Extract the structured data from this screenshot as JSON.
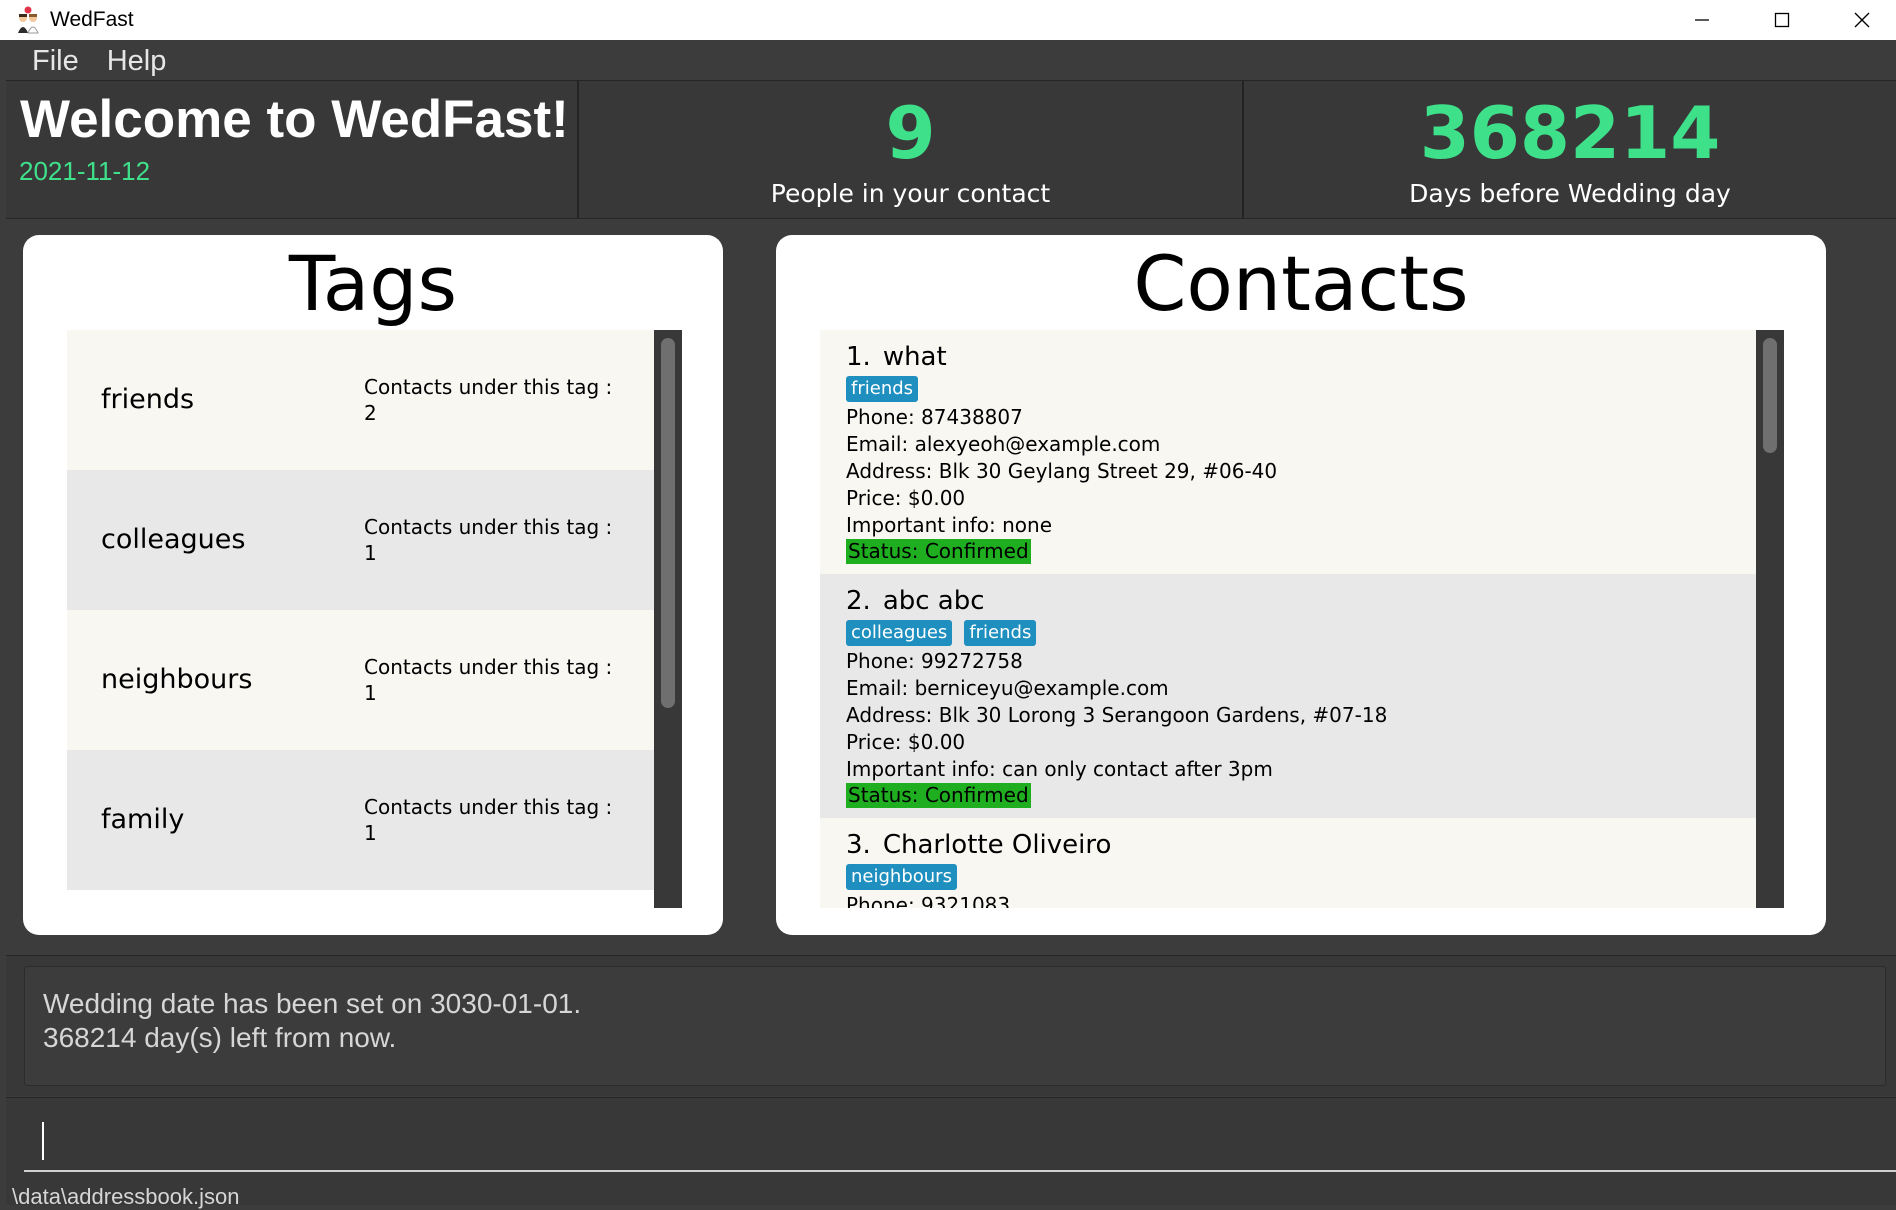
{
  "window": {
    "title": "WedFast",
    "icon": "wedding-couple-icon",
    "controls": [
      "minimize-icon",
      "maximize-icon",
      "close-icon"
    ]
  },
  "menu": {
    "file": "File",
    "help": "Help"
  },
  "header": {
    "welcome": "Welcome to WedFast!",
    "date": "2021-11-12",
    "people_count": "9",
    "people_label": "People in your contact",
    "days_count": "368214",
    "days_label": "Days before Wedding day"
  },
  "colors": {
    "accent_green": "#3fe08a",
    "tag_badge": "#1f8fbf",
    "status_confirmed": "#1fae1f"
  },
  "tags_panel": {
    "heading": "Tags",
    "count_label": "Contacts under this tag :",
    "items": [
      {
        "name": "friends",
        "count": "2"
      },
      {
        "name": "colleagues",
        "count": "1"
      },
      {
        "name": "neighbours",
        "count": "1"
      },
      {
        "name": "family",
        "count": "1"
      }
    ]
  },
  "contacts_panel": {
    "heading": "Contacts",
    "items": [
      {
        "index": "1.",
        "name": "what",
        "tags": [
          "friends"
        ],
        "phone": "Phone: 87438807",
        "email": "Email: alexyeoh@example.com",
        "address": "Address: Blk 30 Geylang Street 29, #06-40",
        "price": "Price: $0.00",
        "info": "Important info: none",
        "status": "Status: Confirmed"
      },
      {
        "index": "2.",
        "name": "abc abc",
        "tags": [
          "colleagues",
          "friends"
        ],
        "phone": "Phone: 99272758",
        "email": "Email: berniceyu@example.com",
        "address": "Address: Blk 30 Lorong 3 Serangoon Gardens, #07-18",
        "price": "Price: $0.00",
        "info": "Important info: can only contact after 3pm",
        "status": "Status: Confirmed"
      },
      {
        "index": "3.",
        "name": "Charlotte Oliveiro",
        "tags": [
          "neighbours"
        ],
        "phone": "Phone: 9321083"
      }
    ]
  },
  "result": {
    "line1": "Wedding date has been set on 3030-01-01.",
    "line2": "368214 day(s) left from now."
  },
  "command": {
    "value": "",
    "placeholder": ""
  },
  "status_bar": {
    "path": "\\data\\addressbook.json"
  }
}
